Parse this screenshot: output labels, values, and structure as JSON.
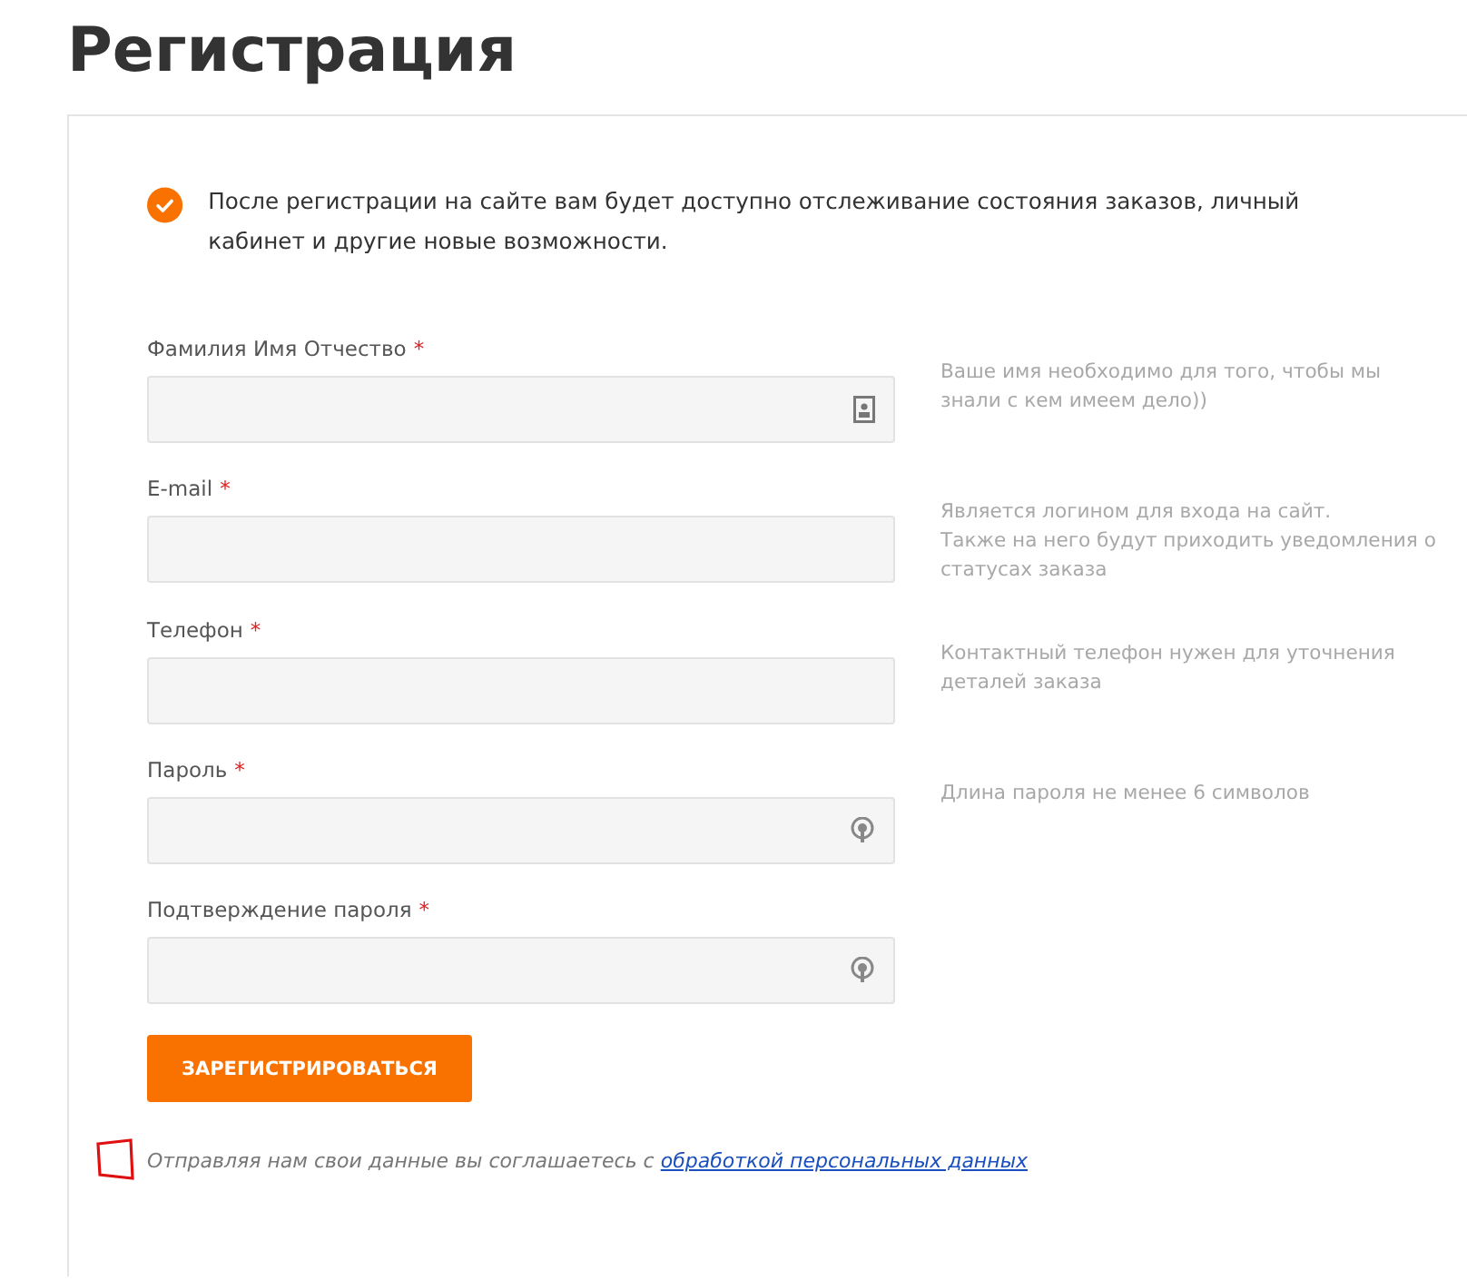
{
  "title": "Регистрация",
  "notice": {
    "text": "После регистрации на сайте вам будет доступно отслеживание состояния заказов, личный кабинет и другие новые возможности."
  },
  "fields": [
    {
      "label": "Фамилия Имя Отчество",
      "mark": "*",
      "hint": "Ваше имя необходимо для того, чтобы мы знали с кем имеем дело))",
      "kind": "contact"
    },
    {
      "label": "E-mail",
      "mark": "*",
      "hint": "Является логином для входа на сайт.\nТакже на него будут приходить уведомления о статусах заказа",
      "kind": "text"
    },
    {
      "label": "Телефон",
      "mark": "*",
      "hint": "Контактный телефон нужен для уточнения деталей заказа",
      "kind": "text"
    },
    {
      "label": "Пароль",
      "mark": "*",
      "hint": "Длина пароля не менее 6 символов",
      "kind": "password"
    },
    {
      "label": "Подтверждение пароля",
      "mark": "*",
      "kind": "password"
    }
  ],
  "submit": "ЗАРЕГИСТРИРОВАТЬСЯ",
  "consent": {
    "text": "Отправляя нам свои данные вы соглашаетесь с",
    "link": "обработкой персональных данных"
  }
}
